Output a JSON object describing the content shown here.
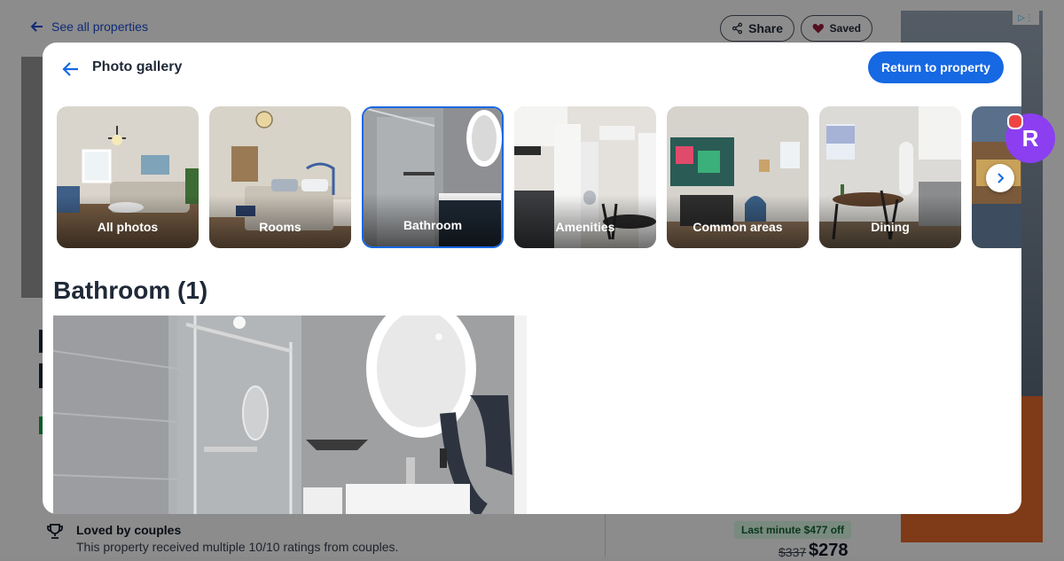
{
  "background": {
    "back_link": "See all properties",
    "share_label": "Share",
    "saved_label": "Saved",
    "highlight": {
      "title": "Loved by couples",
      "description": "This property received multiple 10/10 ratings from couples."
    },
    "deal_badge": "Last minute $477 off",
    "price_old": "$337",
    "price_new": "$278",
    "ad_label": "Ad"
  },
  "modal": {
    "title": "Photo gallery",
    "return_button": "Return to property",
    "categories": [
      {
        "label": "All photos",
        "selected": false
      },
      {
        "label": "Rooms",
        "selected": false
      },
      {
        "label": "Bathroom",
        "selected": true
      },
      {
        "label": "Amenities",
        "selected": false
      },
      {
        "label": "Common areas",
        "selected": false
      },
      {
        "label": "Dining",
        "selected": false
      },
      {
        "label": "",
        "selected": false
      }
    ],
    "section_title": "Bathroom (1)"
  },
  "extension": {
    "letter": "R"
  },
  "colors": {
    "accent": "#1668e3",
    "extension": "#8b3ff0",
    "saved_heart": "#9b1c3a"
  }
}
